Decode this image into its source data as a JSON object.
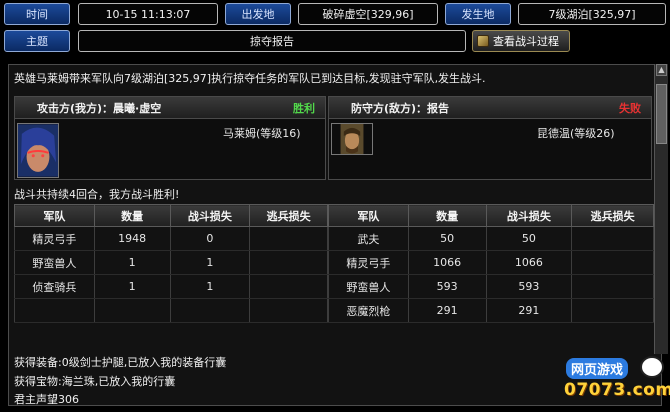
{
  "header": {
    "time_label": "时间",
    "time_value": "10-15 11:13:07",
    "origin_label": "出发地",
    "origin_value": "破碎虚空[329,96]",
    "target_label": "发生地",
    "target_value": "7级湖泊[325,97]",
    "topic_label": "主题",
    "topic_value": "掠夺报告",
    "view_battle_button": "查看战斗过程"
  },
  "report": {
    "intro": "英雄马莱姆带来军队向7级湖泊[325,97]执行掠夺任务的军队已到达目标,发现驻守军队,发生战斗.",
    "summary": "战斗共持续4回合，我方战斗胜利!"
  },
  "attacker": {
    "heading": "攻击方(我方)：晨曦·虚空",
    "result": "胜利",
    "hero": "马莱姆(等级16)"
  },
  "defender": {
    "heading": "防守方(敌方)：报告",
    "result": "失败",
    "hero": "昆德温(等级26)"
  },
  "table_headers": [
    "军队",
    "数量",
    "战斗损失",
    "逃兵损失"
  ],
  "attacker_rows": [
    [
      "精灵弓手",
      "1948",
      "0",
      ""
    ],
    [
      "野蛮兽人",
      "1",
      "1",
      ""
    ],
    [
      "侦查骑兵",
      "1",
      "1",
      ""
    ],
    [
      "",
      "",
      "",
      ""
    ]
  ],
  "defender_rows": [
    [
      "武夫",
      "50",
      "50",
      ""
    ],
    [
      "精灵弓手",
      "1066",
      "1066",
      ""
    ],
    [
      "野蛮兽人",
      "593",
      "593",
      ""
    ],
    [
      "恶魔烈枪",
      "291",
      "291",
      ""
    ]
  ],
  "loot": [
    "获得装备:0级剑士护腿,已放入我的装备行囊",
    "获得宝物:海兰珠,已放入我的行囊",
    "君主声望306"
  ],
  "watermark": {
    "top": "网页游戏",
    "bottom": "07073.com"
  },
  "colors": {
    "win": "#52d94b",
    "lose": "#e83232",
    "header_label_bg": "#1c4a9a"
  }
}
